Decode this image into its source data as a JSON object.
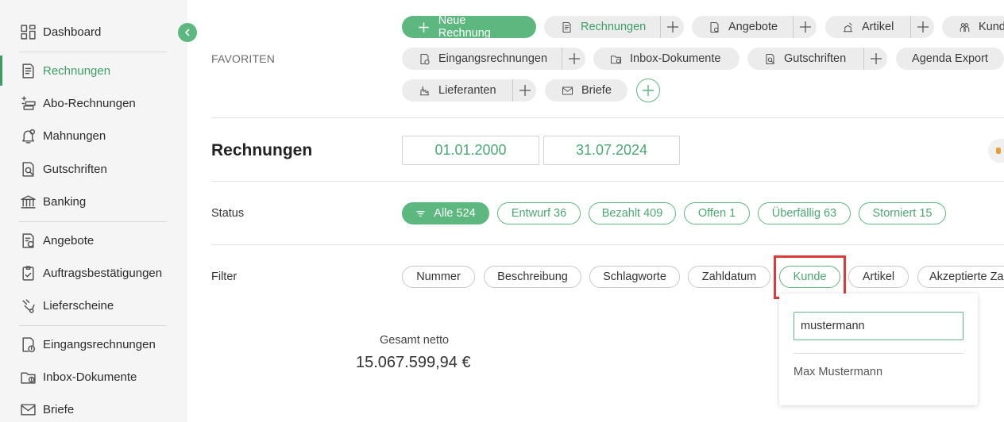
{
  "sidebar": {
    "items": [
      {
        "label": "Dashboard",
        "icon": "dashboard-icon"
      },
      {
        "label": "Rechnungen",
        "icon": "invoice-icon",
        "active": true
      },
      {
        "label": "Abo-Rechnungen",
        "icon": "subscription-icon"
      },
      {
        "label": "Mahnungen",
        "icon": "reminder-icon"
      },
      {
        "label": "Gutschriften",
        "icon": "credit-note-icon"
      },
      {
        "label": "Banking",
        "icon": "bank-icon"
      },
      {
        "label": "Angebote",
        "icon": "offer-icon"
      },
      {
        "label": "Auftragsbestätigungen",
        "icon": "order-confirmation-icon"
      },
      {
        "label": "Lieferscheine",
        "icon": "delivery-note-icon"
      },
      {
        "label": "Eingangsrechnungen",
        "icon": "incoming-invoice-icon"
      },
      {
        "label": "Inbox-Dokumente",
        "icon": "inbox-icon"
      },
      {
        "label": "Briefe",
        "icon": "letter-icon"
      }
    ]
  },
  "favorites": {
    "label": "FAVORITEN",
    "new_invoice": "Neue Rechnung",
    "items": [
      {
        "label": "Rechnungen",
        "icon": "invoice-icon"
      },
      {
        "label": "Angebote",
        "icon": "offer-icon"
      },
      {
        "label": "Artikel",
        "icon": "article-icon"
      },
      {
        "label": "Kunden",
        "icon": "customers-icon"
      },
      {
        "label": "Eingangsrechnungen",
        "icon": "incoming-invoice-icon"
      },
      {
        "label": "Inbox-Dokumente",
        "icon": "inbox-icon"
      },
      {
        "label": "Gutschriften",
        "icon": "credit-note-icon"
      },
      {
        "label": "Agenda Export"
      },
      {
        "label": "Lieferanten",
        "icon": "supplier-icon"
      },
      {
        "label": "Briefe",
        "icon": "letter-icon"
      }
    ]
  },
  "header": {
    "title": "Rechnungen",
    "date_from": "01.01.2000",
    "date_to": "31.07.2024"
  },
  "status": {
    "label": "Status",
    "chips": [
      {
        "label": "Alle 524",
        "active": true
      },
      {
        "label": "Entwurf 36"
      },
      {
        "label": "Bezahlt 409"
      },
      {
        "label": "Offen 1"
      },
      {
        "label": "Überfällig 63"
      },
      {
        "label": "Storniert 15"
      }
    ]
  },
  "filter": {
    "label": "Filter",
    "chips": [
      {
        "label": "Nummer"
      },
      {
        "label": "Beschreibung"
      },
      {
        "label": "Schlagworte"
      },
      {
        "label": "Zahldatum"
      },
      {
        "label": "Kunde",
        "active": true
      },
      {
        "label": "Artikel"
      },
      {
        "label": "Akzeptierte Zahlungsarten"
      }
    ]
  },
  "customer_dropdown": {
    "input_value": "mustermann",
    "options": [
      "Max Mustermann"
    ]
  },
  "totals": {
    "label": "Gesamt netto",
    "value": "15.067.599,94 €"
  },
  "colors": {
    "accent": "#5cb87f",
    "accent_text": "#3a9e63",
    "highlight": "#d93a3a"
  }
}
